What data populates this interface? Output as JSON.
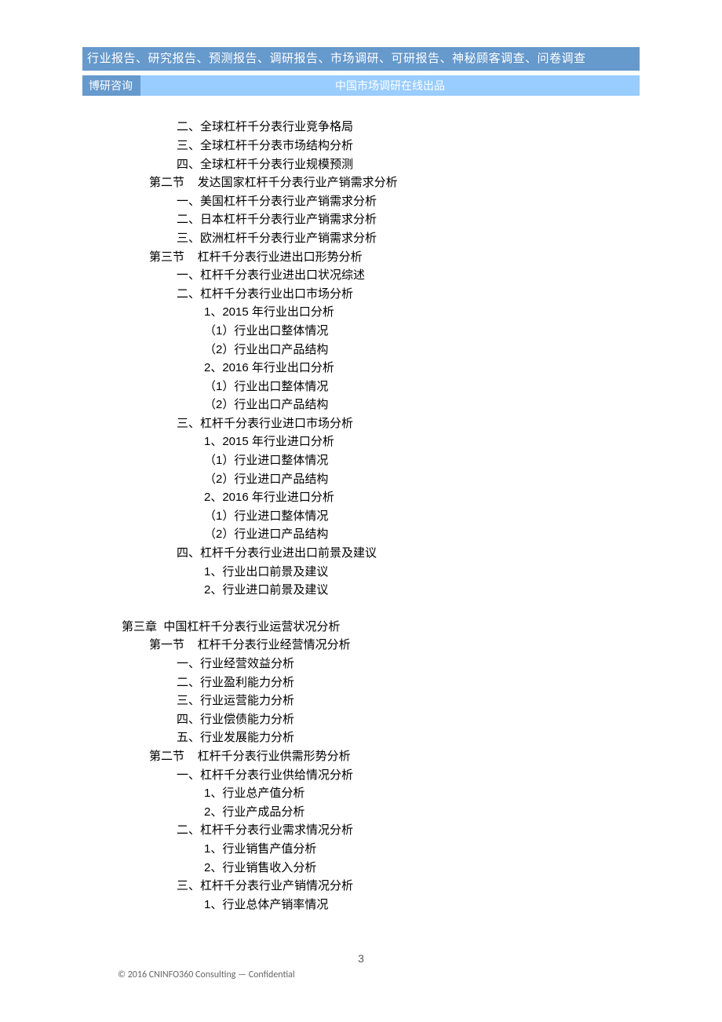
{
  "header": {
    "top_banner": "行业报告、研究报告、预测报告、调研报告、市场调研、可研报告、神秘顾客调查、问卷调查",
    "sub_left": "博研咨询",
    "sub_right": "中国市场调研在线出品"
  },
  "toc": [
    {
      "indent": 2,
      "text": "二、全球杠杆千分表行业竞争格局"
    },
    {
      "indent": 2,
      "text": "三、全球杠杆千分表市场结构分析"
    },
    {
      "indent": 2,
      "text": "四、全球杠杆千分表行业规模预测"
    },
    {
      "indent": 1,
      "text": "第二节    发达国家杠杆千分表行业产销需求分析"
    },
    {
      "indent": 2,
      "text": "一、美国杠杆千分表行业产销需求分析"
    },
    {
      "indent": 2,
      "text": "二、日本杠杆千分表行业产销需求分析"
    },
    {
      "indent": 2,
      "text": "三、欧洲杠杆千分表行业产销需求分析"
    },
    {
      "indent": 1,
      "text": "第三节    杠杆千分表行业进出口形势分析"
    },
    {
      "indent": 2,
      "text": "一、杠杆千分表行业进出口状况综述"
    },
    {
      "indent": 2,
      "text": "二、杠杆千分表行业出口市场分析"
    },
    {
      "indent": 3,
      "text": "1、2015 年行业出口分析"
    },
    {
      "indent": 3,
      "text": "（1）行业出口整体情况"
    },
    {
      "indent": 3,
      "text": "（2）行业出口产品结构"
    },
    {
      "indent": 3,
      "text": "2、2016 年行业出口分析"
    },
    {
      "indent": 3,
      "text": "（1）行业出口整体情况"
    },
    {
      "indent": 3,
      "text": "（2）行业出口产品结构"
    },
    {
      "indent": 2,
      "text": "三、杠杆千分表行业进口市场分析"
    },
    {
      "indent": 3,
      "text": "1、2015 年行业进口分析"
    },
    {
      "indent": 3,
      "text": "（1）行业进口整体情况"
    },
    {
      "indent": 3,
      "text": "（2）行业进口产品结构"
    },
    {
      "indent": 3,
      "text": "2、2016 年行业进口分析"
    },
    {
      "indent": 3,
      "text": "（1）行业进口整体情况"
    },
    {
      "indent": 3,
      "text": "（2）行业进口产品结构"
    },
    {
      "indent": 2,
      "text": "四、杠杆千分表行业进出口前景及建议"
    },
    {
      "indent": 3,
      "text": "1、行业出口前景及建议"
    },
    {
      "indent": 3,
      "text": "2、行业进口前景及建议"
    },
    {
      "indent": 0,
      "text": "第三章  中国杠杆千分表行业运营状况分析",
      "gap": true
    },
    {
      "indent": 1,
      "text": "第一节    杠杆千分表行业经营情况分析"
    },
    {
      "indent": 2,
      "text": "一、行业经营效益分析"
    },
    {
      "indent": 2,
      "text": "二、行业盈利能力分析"
    },
    {
      "indent": 2,
      "text": "三、行业运营能力分析"
    },
    {
      "indent": 2,
      "text": "四、行业偿债能力分析"
    },
    {
      "indent": 2,
      "text": "五、行业发展能力分析"
    },
    {
      "indent": 1,
      "text": "第二节    杠杆千分表行业供需形势分析"
    },
    {
      "indent": 2,
      "text": "一、杠杆千分表行业供给情况分析"
    },
    {
      "indent": 3,
      "text": "1、行业总产值分析"
    },
    {
      "indent": 3,
      "text": "2、行业产成品分析"
    },
    {
      "indent": 2,
      "text": "二、杠杆千分表行业需求情况分析"
    },
    {
      "indent": 3,
      "text": "1、行业销售产值分析"
    },
    {
      "indent": 3,
      "text": "2、行业销售收入分析"
    },
    {
      "indent": 2,
      "text": "三、杠杆千分表行业产销情况分析"
    },
    {
      "indent": 3,
      "text": "1、行业总体产销率情况"
    }
  ],
  "page_number": "3",
  "footer": "© 2016 CNINFO360 Consulting — Confidential"
}
